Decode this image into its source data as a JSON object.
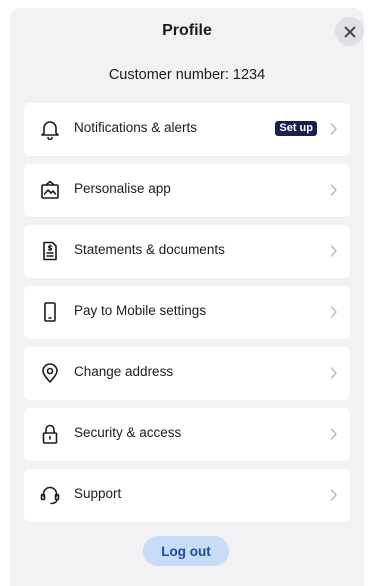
{
  "header": {
    "title": "Profile",
    "close_icon": "close-icon"
  },
  "customer_number": "Customer number: 1234",
  "menu": [
    {
      "label": "Notifications & alerts",
      "icon": "bell-icon",
      "badge": "Set up"
    },
    {
      "label": "Personalise app",
      "icon": "personalise-icon"
    },
    {
      "label": "Statements & documents",
      "icon": "document-icon"
    },
    {
      "label": "Pay to Mobile settings",
      "icon": "mobile-phone-icon"
    },
    {
      "label": "Change address",
      "icon": "location-pin-icon"
    },
    {
      "label": "Security & access",
      "icon": "lock-icon"
    },
    {
      "label": "Support",
      "icon": "headset-icon"
    }
  ],
  "logout_label": "Log out",
  "colors": {
    "sheet_background": "#f2f2f4",
    "badge_background": "#1a1f4d",
    "logout_background": "#c8dcf5",
    "logout_text": "#1c4ba0"
  }
}
